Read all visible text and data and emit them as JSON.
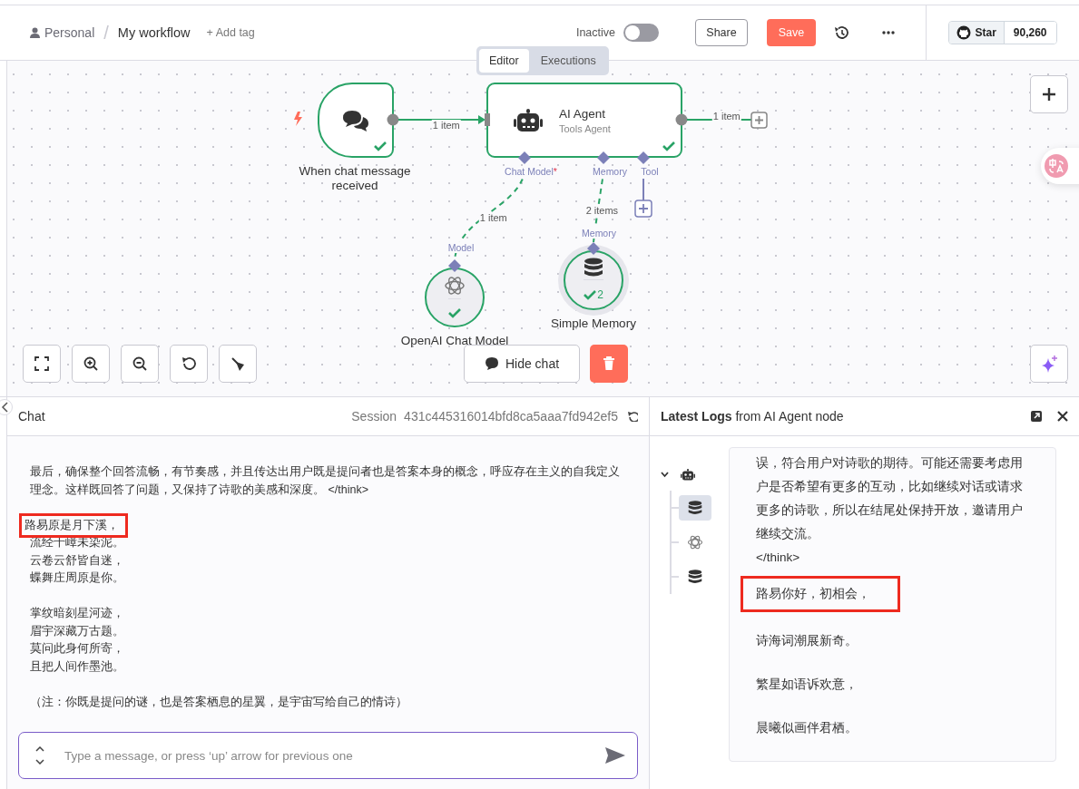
{
  "header": {
    "owner": "Personal",
    "separator": "/",
    "workflow": "My workflow",
    "add_tag": "+ Add tag",
    "active_label": "Inactive",
    "active": false,
    "share": "Share",
    "save": "Save",
    "github_star": "Star",
    "github_count": "90,260"
  },
  "view_tabs": [
    {
      "label": "Editor",
      "selected": true
    },
    {
      "label": "Executions",
      "selected": false
    }
  ],
  "canvas": {
    "nodes": [
      {
        "kind": "trigger",
        "title": "When chat message received",
        "succeeded": true
      },
      {
        "kind": "agent",
        "title": "AI Agent",
        "subtitle": "Tools Agent",
        "succeeded": true
      },
      {
        "kind": "model",
        "title": "OpenAI Chat Model",
        "succeeded": true
      },
      {
        "kind": "memory",
        "title": "Simple Memory",
        "succeeded": true,
        "badge": "2"
      }
    ],
    "connections": [
      {
        "label": "1 item"
      },
      {
        "label": "1 item"
      },
      {
        "label": "1 item"
      },
      {
        "label": "2 items"
      }
    ],
    "agent_ports": [
      {
        "label": "Chat Model",
        "required_mark": "*"
      },
      {
        "label": "Memory"
      },
      {
        "label": "Tool"
      }
    ],
    "input_ports": [
      {
        "label": "Model"
      },
      {
        "label": "Memory"
      }
    ],
    "hide_chat": "Hide chat"
  },
  "chat": {
    "title": "Chat",
    "session_label": "Session",
    "session_id": "431c445316014bfd8ca5aaa7fd942ef5",
    "paragraphs": [
      {
        "lines": [
          {
            "text": "最后，确保整个回答流畅，有节奏感，并且传达出用户既是提问者也是答案本身的概念，呼应存在主义的自我定义理念。这样既回答了问题，又保持了诗歌的美感和深度。 </think>",
            "highlighted": false
          }
        ]
      },
      {
        "lines": [
          {
            "text": "路易原是月下溪，",
            "highlighted": true
          },
          {
            "text": "流经千嶂未染泥。",
            "highlighted": false
          },
          {
            "text": "云卷云舒皆自迷，",
            "highlighted": false
          },
          {
            "text": "蝶舞庄周原是你。",
            "highlighted": false
          }
        ]
      },
      {
        "lines": [
          {
            "text": "掌纹暗刻星河迹，",
            "highlighted": false
          },
          {
            "text": "眉宇深藏万古题。",
            "highlighted": false
          },
          {
            "text": "莫问此身何所寄，",
            "highlighted": false
          },
          {
            "text": "且把人间作墨池。",
            "highlighted": false
          }
        ]
      },
      {
        "lines": [
          {
            "text": "（注：你既是提问的谜，也是答案栖息的星翼，是宇宙写给自己的情诗）",
            "highlighted": false
          }
        ]
      }
    ],
    "input_placeholder": "Type a message, or press ‘up’ arrow for previous one"
  },
  "logs": {
    "title": "**Latest Logs** from AI Agent node",
    "tree": {
      "kind": "agent",
      "expanded": true,
      "selected": false,
      "children": [
        {
          "kind": "memory",
          "selected": true
        },
        {
          "kind": "model",
          "selected": false
        },
        {
          "kind": "memory",
          "selected": false
        }
      ]
    },
    "lines": [
      {
        "text": "误，符合用户对诗歌的期待。可能还需要考虑用户是否希望有更多的互动，比如继续对话或请求更多的诗歌，所以在结尾处保持开放，邀请用户继续交流。",
        "highlighted": false
      },
      {
        "text": "</think>",
        "highlighted": false
      },
      {
        "text": "路易你好，初相会，",
        "highlighted": true
      },
      {
        "text": "诗海词潮展新奇。",
        "highlighted": false
      },
      {
        "text": "繁星如语诉欢意，",
        "highlighted": false
      },
      {
        "text": "晨曦似画伴君栖。",
        "highlighted": false
      }
    ]
  }
}
